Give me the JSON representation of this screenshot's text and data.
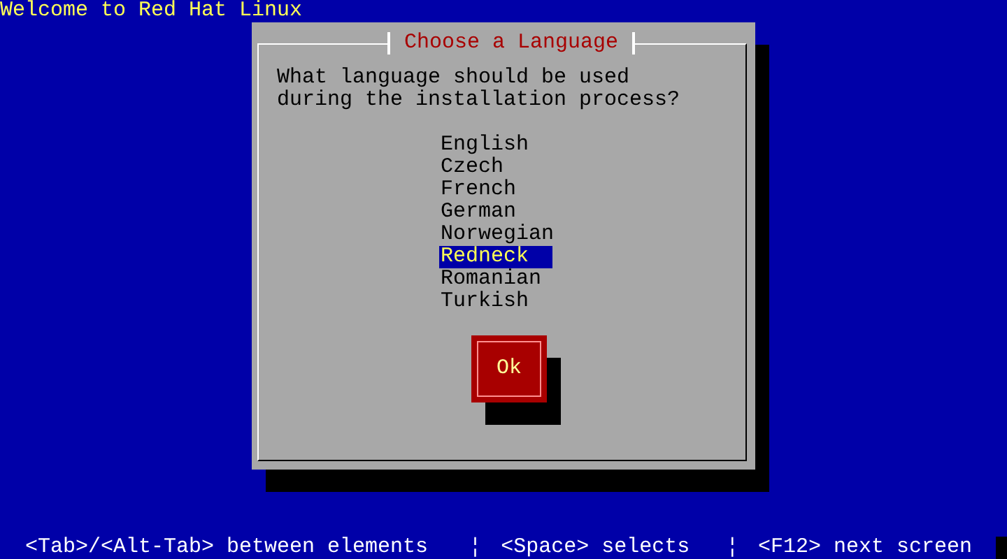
{
  "screen_title": "Welcome to Red Hat Linux",
  "dialog": {
    "title": "Choose a Language",
    "question": "What language should be used during the installation process?",
    "languages": [
      {
        "label": "English",
        "selected": false
      },
      {
        "label": "Czech",
        "selected": false
      },
      {
        "label": "French",
        "selected": false
      },
      {
        "label": "German",
        "selected": false
      },
      {
        "label": "Norwegian",
        "selected": false
      },
      {
        "label": "Redneck",
        "selected": true
      },
      {
        "label": "Romanian",
        "selected": false
      },
      {
        "label": "Turkish",
        "selected": false
      }
    ],
    "button": "Ok"
  },
  "help_line": [
    "<Tab>/<Alt-Tab> between elements",
    "<Space> selects",
    "<F12> next screen"
  ],
  "separators": [
    "¦",
    "¦"
  ]
}
